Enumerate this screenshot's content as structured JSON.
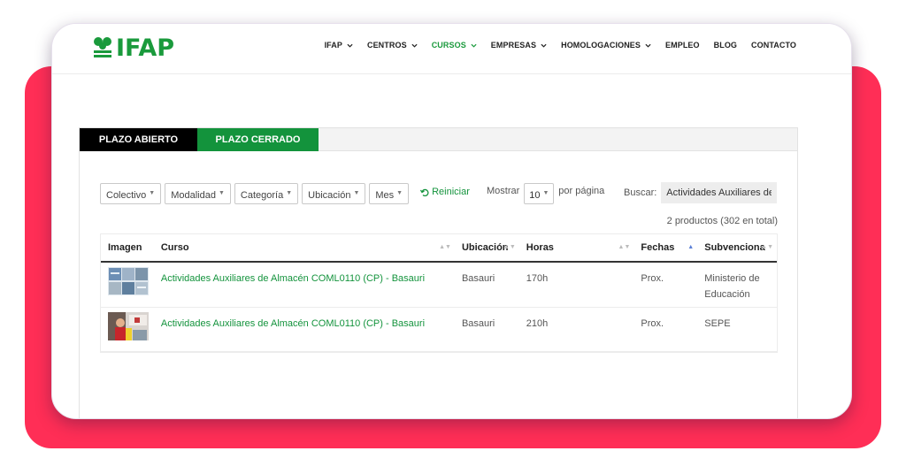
{
  "header": {
    "logo_text": "IFAP",
    "nav": [
      {
        "label": "IFAP",
        "dropdown": true,
        "active": false
      },
      {
        "label": "CENTROS",
        "dropdown": true,
        "active": false
      },
      {
        "label": "CURSOS",
        "dropdown": true,
        "active": true
      },
      {
        "label": "EMPRESAS",
        "dropdown": true,
        "active": false
      },
      {
        "label": "HOMOLOGACIONES",
        "dropdown": true,
        "active": false
      },
      {
        "label": "EMPLEO",
        "dropdown": false,
        "active": false
      },
      {
        "label": "BLOG",
        "dropdown": false,
        "active": false
      },
      {
        "label": "CONTACTO",
        "dropdown": false,
        "active": false
      }
    ]
  },
  "tabs": {
    "open": "PLAZO ABIERTO",
    "closed": "PLAZO CERRADO"
  },
  "filters": {
    "colectivo": "Colectivo",
    "modalidad": "Modalidad",
    "categoria": "Categoría",
    "ubicacion": "Ubicación",
    "mes": "Mes",
    "reset": "Reiniciar"
  },
  "paging": {
    "show_label": "Mostrar",
    "per_page_value": "10",
    "per_page_label": "por página"
  },
  "search": {
    "label": "Buscar:",
    "value": "Actividades Auxiliares de"
  },
  "total": "2 productos (302 en total)",
  "table": {
    "headers": {
      "imagen": "Imagen",
      "curso": "Curso",
      "ubicacion": "Ubicación",
      "horas": "Horas",
      "fechas": "Fechas",
      "subvenciona": "Subvenciona"
    },
    "rows": [
      {
        "curso": "Actividades Auxiliares de Almacén COML0110 (CP) - Basauri",
        "ubicacion": "Basauri",
        "horas": "170h",
        "fechas": "Prox.",
        "subvenciona_line1": "Ministerio de",
        "subvenciona_line2": "Educación"
      },
      {
        "curso": "Actividades Auxiliares de Almacén COML0110 (CP) - Basauri",
        "ubicacion": "Basauri",
        "horas": "210h",
        "fechas": "Prox.",
        "subvenciona_line1": "SEPE",
        "subvenciona_line2": ""
      }
    ]
  },
  "colors": {
    "brand_green": "#13933c",
    "backdrop_red": "#ff2e56",
    "tab_black": "#000000"
  }
}
